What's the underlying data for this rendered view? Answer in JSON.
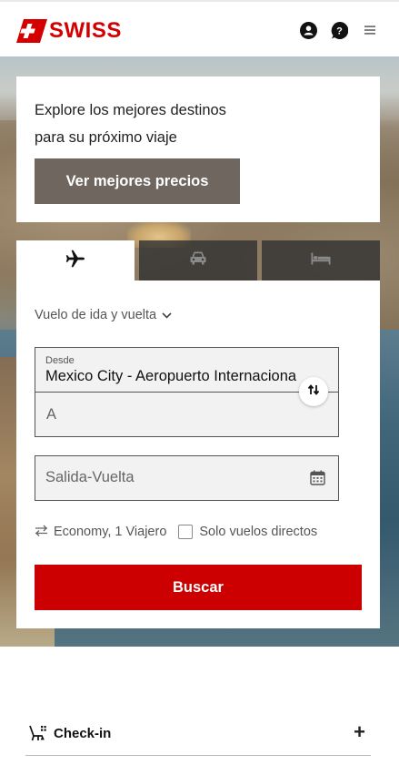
{
  "header": {
    "logo_text": "SWISS",
    "brand_color": "#d40000",
    "icons": [
      "account-icon",
      "help-icon",
      "menu-icon"
    ]
  },
  "promo": {
    "line1": "Explore los mejores destinos",
    "line2": "para su próximo viaje",
    "button_label": "Ver mejores precios"
  },
  "tabs": [
    {
      "icon": "airplane-icon",
      "active": true
    },
    {
      "icon": "car-icon",
      "active": false
    },
    {
      "icon": "bed-icon",
      "active": false
    }
  ],
  "booking": {
    "trip_type": "Vuelo de ida y vuelta",
    "from_label": "Desde",
    "from_value": "Mexico City - Aeropuerto Internaciona",
    "to_placeholder": "A",
    "dates_placeholder": "Salida-Vuelta",
    "passengers": "Economy, 1 Viajero",
    "direct_only_label": "Solo vuelos directos",
    "direct_only_checked": false,
    "search_label": "Buscar",
    "search_color": "#cc0000"
  },
  "checkin": {
    "label": "Check-in",
    "expand_symbol": "+"
  }
}
